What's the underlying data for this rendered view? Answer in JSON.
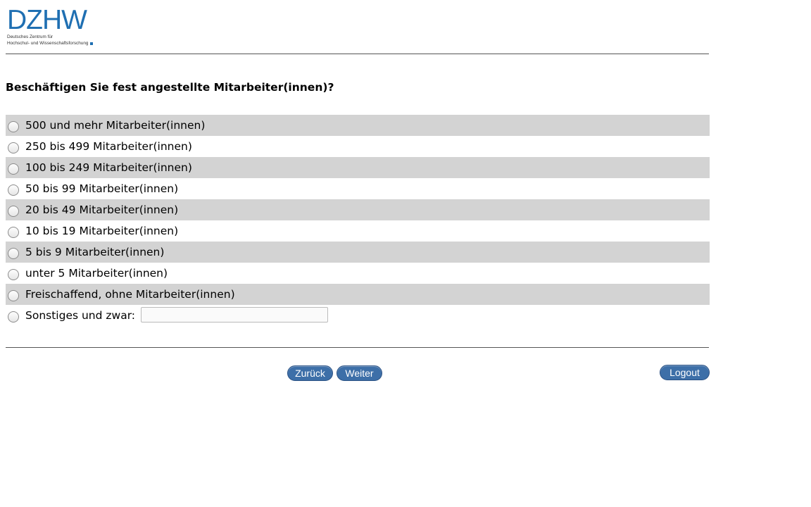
{
  "logo": {
    "wordmark": "DZHW",
    "line1": "Deutsches Zentrum für",
    "line2": "Hochschul- und Wissenschaftsforschung",
    "brand_color": "#1f6fb2"
  },
  "question": "Beschäftigen Sie fest angestellte Mitarbeiter(innen)?",
  "options": [
    {
      "label": "500 und mehr Mitarbeiter(innen)",
      "selected": false
    },
    {
      "label": "250 bis 499 Mitarbeiter(innen)",
      "selected": false
    },
    {
      "label": "100 bis 249 Mitarbeiter(innen)",
      "selected": false
    },
    {
      "label": "50 bis 99 Mitarbeiter(innen)",
      "selected": false
    },
    {
      "label": "20 bis 49 Mitarbeiter(innen)",
      "selected": false
    },
    {
      "label": "10 bis 19 Mitarbeiter(innen)",
      "selected": false
    },
    {
      "label": "5 bis 9 Mitarbeiter(innen)",
      "selected": false
    },
    {
      "label": "unter 5 Mitarbeiter(innen)",
      "selected": false
    },
    {
      "label": "Freischaffend, ohne Mitarbeiter(innen)",
      "selected": false
    },
    {
      "label": "Sonstiges und zwar:",
      "selected": false,
      "input_value": ""
    }
  ],
  "buttons": {
    "back": "Zurück",
    "next": "Weiter",
    "logout": "Logout"
  },
  "colors": {
    "row_shade": "#d3d3d3",
    "button_bg": "#3d6fa8"
  }
}
